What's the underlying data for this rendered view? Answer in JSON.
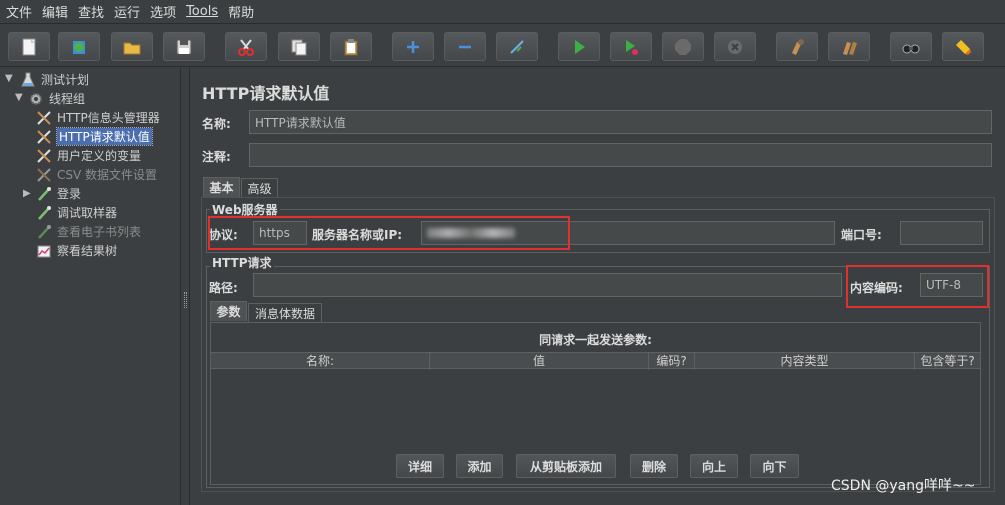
{
  "menu": [
    "文件",
    "编辑",
    "查找",
    "运行",
    "选项",
    "Tools",
    "帮助"
  ],
  "toolbar": [
    {
      "name": "new-icon"
    },
    {
      "name": "templates-icon"
    },
    {
      "name": "open-icon"
    },
    {
      "name": "save-icon"
    },
    {
      "name": "cut-icon"
    },
    {
      "name": "copy-icon"
    },
    {
      "name": "paste-icon"
    },
    {
      "name": "expand-icon"
    },
    {
      "name": "collapse-icon"
    },
    {
      "name": "toggle-icon"
    },
    {
      "name": "start-icon"
    },
    {
      "name": "start-no-pause-icon"
    },
    {
      "name": "stop-icon"
    },
    {
      "name": "shutdown-icon"
    },
    {
      "name": "clear-icon"
    },
    {
      "name": "clear-all-icon"
    },
    {
      "name": "search-icon"
    },
    {
      "name": "reset-search-icon"
    }
  ],
  "tree": {
    "items": [
      {
        "label": "测试计划",
        "icon": "test-plan-icon"
      },
      {
        "label": "线程组",
        "icon": "thread-group-icon"
      },
      {
        "label": "HTTP信息头管理器",
        "icon": "config-element-icon"
      },
      {
        "label": "HTTP请求默认值",
        "icon": "config-element-icon",
        "selected": true
      },
      {
        "label": "用户定义的变量",
        "icon": "config-element-icon"
      },
      {
        "label": "CSV 数据文件设置",
        "icon": "config-element-icon",
        "disabled": true
      },
      {
        "label": "登录",
        "icon": "sampler-icon"
      },
      {
        "label": "调试取样器",
        "icon": "sampler-icon"
      },
      {
        "label": "查看电子书列表",
        "icon": "sampler-icon",
        "disabled": true
      },
      {
        "label": "察看结果树",
        "icon": "listener-icon"
      }
    ]
  },
  "panel": {
    "title": "HTTP请求默认值",
    "name_label": "名称:",
    "name_value": "HTTP请求默认值",
    "comment_label": "注释:",
    "comment_value": "",
    "tabs": [
      "基本",
      "高级"
    ],
    "web_server": {
      "title": "Web服务器",
      "protocol_label": "协议:",
      "protocol_value": "https",
      "server_label": "服务器名称或IP:",
      "port_label": "端口号:",
      "port_value": ""
    },
    "http_request": {
      "title": "HTTP请求",
      "path_label": "路径:",
      "path_value": "",
      "encoding_label": "内容编码:",
      "encoding_value": "UTF-8"
    },
    "sub_tabs": [
      "参数",
      "消息体数据"
    ],
    "params": {
      "caption": "同请求一起发送参数:",
      "columns": [
        "名称:",
        "值",
        "编码?",
        "内容类型",
        "包含等于?"
      ]
    },
    "buttons": [
      "详细",
      "添加",
      "从剪贴板添加",
      "删除",
      "向上",
      "向下"
    ]
  },
  "watermark": "CSDN @yang咩咩~~"
}
